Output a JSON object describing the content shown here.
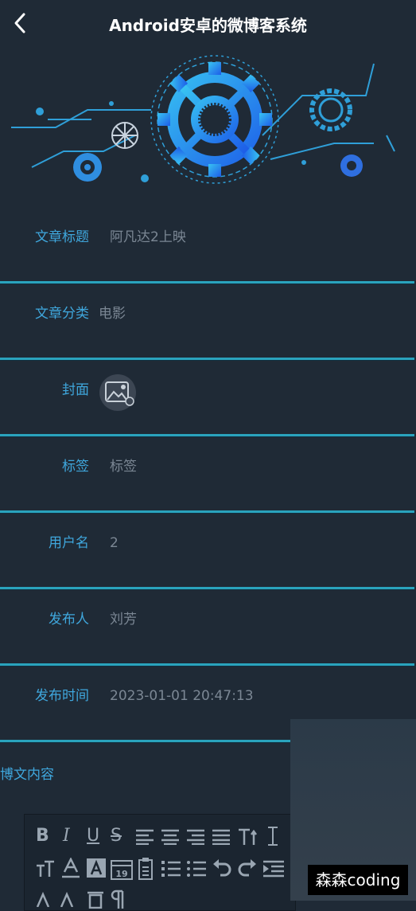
{
  "header": {
    "title": "Android安卓的微博客系统"
  },
  "form": {
    "rows": [
      {
        "label": "文章标题",
        "value": "阿凡达2上映"
      },
      {
        "label": "文章分类",
        "value": "电影"
      },
      {
        "label": "封面",
        "value": ""
      },
      {
        "label": "标签",
        "value": "标签"
      },
      {
        "label": "用户名",
        "value": "2"
      },
      {
        "label": "发布人",
        "value": "刘芳"
      },
      {
        "label": "发布时间",
        "value": "2023-01-01 20:47:13"
      }
    ],
    "content_label": "博文内容"
  },
  "editor": {
    "toolbar_row1": [
      "B",
      "I",
      "U",
      "S"
    ],
    "toolbar_row2_text": "T",
    "date_day": "19"
  },
  "watermark": {
    "text": "森森coding"
  },
  "colors": {
    "background": "#1f2a36",
    "accent": "#3fa7dd",
    "divider": "#2aa3bd"
  }
}
